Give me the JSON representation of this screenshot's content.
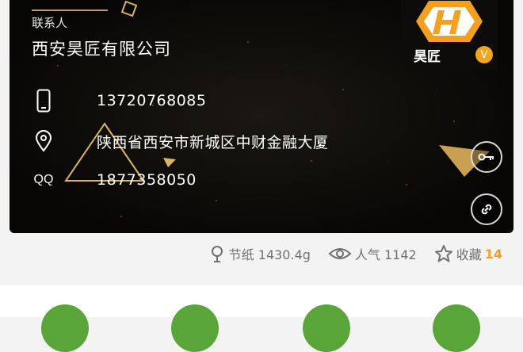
{
  "card": {
    "contact_label": "联系人",
    "company_name": "西安昊匠有限公司",
    "phone": "13720768085",
    "address": "陕西省西安市新城区中财金融大厦",
    "qq_label": "QQ",
    "qq_number": "1877358050"
  },
  "logo": {
    "brand_subtext": "昊匠",
    "badge": "V"
  },
  "stats": {
    "paper_saved": "节纸 1430.4g",
    "popularity": "人气 1142",
    "favorites_label": "收藏",
    "favorites_count": "14"
  },
  "colors": {
    "accent_orange": "#f2a51f",
    "action_green": "#5aa53a",
    "card_bg": "#0a0908"
  }
}
